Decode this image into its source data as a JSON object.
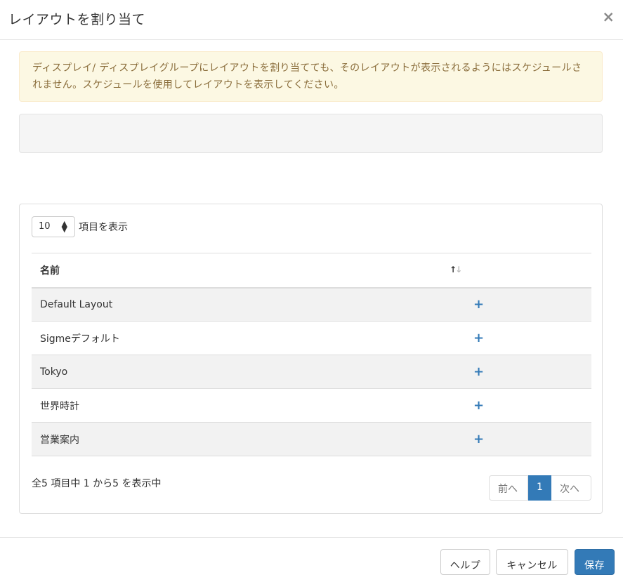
{
  "modal": {
    "title": "レイアウトを割り当て",
    "close_icon": "×"
  },
  "alert": {
    "message": "ディスプレイ/ ディスプレイグループにレイアウトを割り当てても、そのレイアウトが表示されるようにはスケジュールされません。スケジュールを使用してレイアウトを表示してください。"
  },
  "length": {
    "value": "10",
    "label": "項目を表示"
  },
  "table": {
    "header_name": "名前",
    "rows": [
      {
        "name": "Default Layout",
        "action": "+"
      },
      {
        "name": "Sigmeデフォルト",
        "action": "+"
      },
      {
        "name": "Tokyo",
        "action": "+"
      },
      {
        "name": "世界時計",
        "action": "+"
      },
      {
        "name": "営業案内",
        "action": "+"
      }
    ]
  },
  "info": "全5 項目中 1 から5 を表示中",
  "pagination": {
    "prev": "前へ",
    "current": "1",
    "next": "次へ"
  },
  "footer": {
    "help": "ヘルプ",
    "cancel": "キャンセル",
    "save": "保存"
  },
  "colors": {
    "primary": "#337ab7",
    "alert_bg": "#fcf8e3",
    "alert_text": "#8a6d3b"
  }
}
